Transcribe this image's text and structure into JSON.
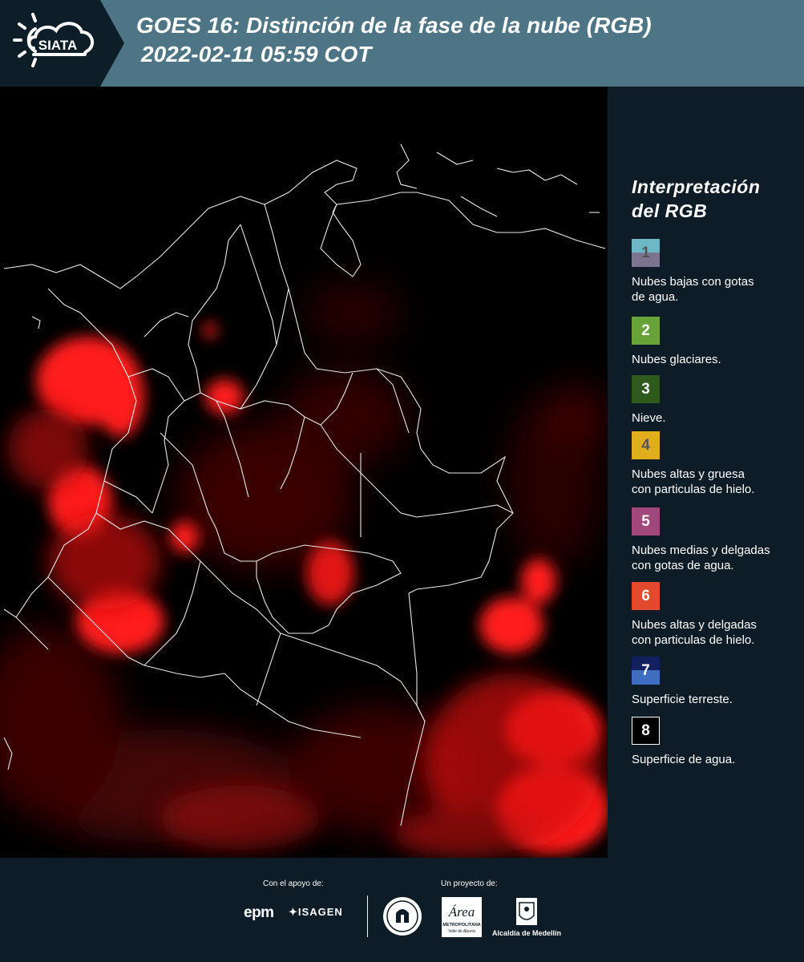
{
  "header": {
    "logo_text": "SIATA",
    "title_line1": "GOES 16: Distinción de la fase de la nube (RGB)",
    "title_line2": "2022-02-11 05:59 COT",
    "bg_color": "#4d7585"
  },
  "legend": {
    "title_line1": "Interpretación",
    "title_line2": "del RGB",
    "items": [
      {
        "number": "1",
        "label_line1": "Nubes bajas con gotas",
        "label_line2": "de agua.",
        "top_color": "#6cb8c6",
        "bottom_color": "#7b7590",
        "number_color": "#555555"
      },
      {
        "number": "2",
        "label_line1": "Nubes glaciares.",
        "label_line2": "",
        "top_color": "#68a33a",
        "bottom_color": "#68a33a",
        "number_color": "#ffffff"
      },
      {
        "number": "3",
        "label_line1": "Nieve.",
        "label_line2": "",
        "top_color": "#2f5a1e",
        "bottom_color": "#2f5a1e",
        "number_color": "#ffffff"
      },
      {
        "number": "4",
        "label_line1": "Nubes altas y gruesa",
        "label_line2": "con particulas de hielo.",
        "top_color": "#e0ad1c",
        "bottom_color": "#e0ad1c",
        "number_color": "#555555"
      },
      {
        "number": "5",
        "label_line1": "Nubes medias y delgadas",
        "label_line2": "con gotas de agua.",
        "top_color": "#a2477b",
        "bottom_color": "#a2477b",
        "number_color": "#ffffff"
      },
      {
        "number": "6",
        "label_line1": "Nubes altas y delgadas",
        "label_line2": "con particulas de hielo.",
        "top_color": "#e14a2b",
        "bottom_color": "#e14a2b",
        "number_color": "#ffffff"
      },
      {
        "number": "7",
        "label_line1": "Superficie terreste.",
        "label_line2": "",
        "top_color": "#13205f",
        "bottom_color": "#3f6ec0",
        "number_color": "#ffffff"
      },
      {
        "number": "8",
        "label_line1": "Superficie de agua.",
        "label_line2": "",
        "top_color": "#000000",
        "bottom_color": "#000000",
        "number_color": "#ffffff"
      }
    ]
  },
  "footer": {
    "support_label": "Con el apoyo de:",
    "project_label": "Un proyecto de:",
    "sponsor_1": "epm",
    "sponsor_2": "ISAGEN",
    "partner_alcaldia": "Alcaldía de Medellín",
    "partner_area_line1": "Área",
    "partner_area_line2": "METROPOLITANA",
    "partner_area_line3": "Valle de Aburrá"
  },
  "colors": {
    "panel_bg": "#0d1c26",
    "map_bg": "#000000",
    "cloud_red": "#ff1a1a"
  }
}
